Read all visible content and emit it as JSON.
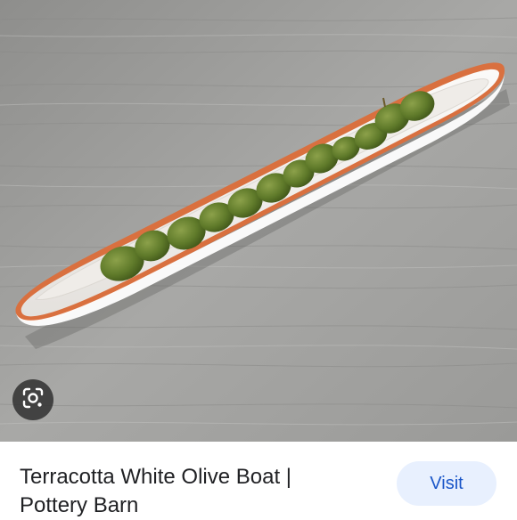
{
  "result": {
    "title_line1": "Terracotta White Olive Boat |",
    "title_line2": "Pottery Barn"
  },
  "actions": {
    "visit_label": "Visit"
  },
  "icons": {
    "lens": "google-lens-icon"
  },
  "colors": {
    "visit_bg": "#e8f0fe",
    "visit_text": "#1a56c8",
    "title_text": "#202124",
    "dish_rim": "#d9703f",
    "dish_body": "#f4f2ef",
    "olive": "#5f7a2a",
    "table": "#a3a3a1"
  }
}
